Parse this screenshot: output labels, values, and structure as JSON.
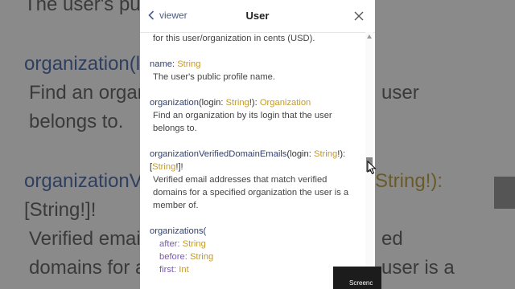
{
  "header": {
    "back_label": "viewer",
    "title": "User"
  },
  "fields": {
    "truncated_desc": "for this user/organization in cents (USD).",
    "name": {
      "label": "name",
      "sep": ": ",
      "type": "String",
      "desc": "The user's public profile name."
    },
    "organization": {
      "label": "organization",
      "arg_open": "(login: ",
      "arg_type": "String",
      "arg_close": "!): ",
      "type": "Organization",
      "desc": "Find an organization by its login that the user belongs to."
    },
    "verified": {
      "label": "organizationVerifiedDomainEmails",
      "arg_open": "(login: ",
      "arg_type": "String",
      "arg_close": "!):",
      "ret_open": "[",
      "ret_type": "String",
      "ret_close": "!]!",
      "desc": "Verified email addresses that match verified domains for a specified organization the user is a member of."
    },
    "organizations": {
      "label": "organizations(",
      "args": [
        {
          "name": "after",
          "type": "String"
        },
        {
          "name": "before",
          "type": "String"
        },
        {
          "name": "first",
          "type": "Int"
        }
      ]
    }
  },
  "background_text": {
    "l1": "The user's pub",
    "l2_fn": "organization(lo",
    "l3": "Find an organ",
    "l3r": "user",
    "l4": "belongs to.",
    "l5_fn": "organizationV",
    "l5r": "String!):",
    "l6": "[String!]!",
    "l7": "Verified email",
    "l7r": "ed",
    "l8": "domains for a",
    "l8r": "user is a",
    "watermark": "Screenc"
  },
  "colors": {
    "field": "#2f3f72",
    "type": "#c19a2e",
    "arg": "#7a5bb0"
  }
}
